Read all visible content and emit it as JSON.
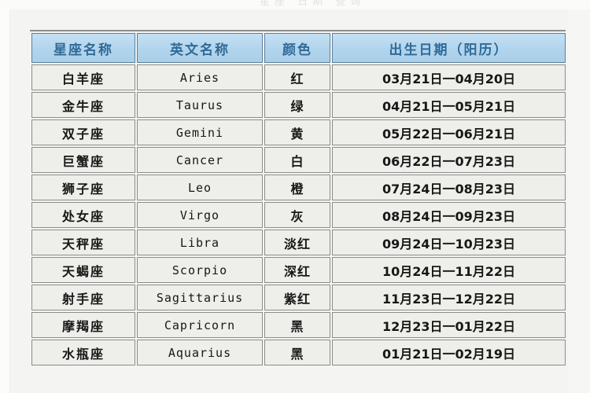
{
  "page": {
    "background_color": "#f4f5f3",
    "top_ghost_text": "星座  日期  查询"
  },
  "table": {
    "name": "zodiac-sign-table",
    "header_background": "#b0d4ee",
    "header_text_color": "#2f6a99",
    "cell_background": "#eeeeea",
    "border_color": "#8a8d8a",
    "columns": [
      {
        "key": "name",
        "label": "星座名称"
      },
      {
        "key": "en",
        "label": "英文名称"
      },
      {
        "key": "color",
        "label": "颜色"
      },
      {
        "key": "date",
        "label": "出生日期（阳历）"
      }
    ],
    "rows": [
      {
        "name": "白羊座",
        "en": "Aries",
        "color": "红",
        "date": "03月21日一04月20日"
      },
      {
        "name": "金牛座",
        "en": "Taurus",
        "color": "绿",
        "date": "04月21日一05月21日"
      },
      {
        "name": "双子座",
        "en": "Gemini",
        "color": "黄",
        "date": "05月22日一06月21日"
      },
      {
        "name": "巨蟹座",
        "en": "Cancer",
        "color": "白",
        "date": "06月22日一07月23日"
      },
      {
        "name": "狮子座",
        "en": "Leo",
        "color": "橙",
        "date": "07月24日一08月23日"
      },
      {
        "name": "处女座",
        "en": "Virgo",
        "color": "灰",
        "date": "08月24日一09月23日"
      },
      {
        "name": "天秤座",
        "en": "Libra",
        "color": "淡红",
        "date": "09月24日一10月23日"
      },
      {
        "name": "天蝎座",
        "en": "Scorpio",
        "color": "深红",
        "date": "10月24日一11月22日"
      },
      {
        "name": "射手座",
        "en": "Sagittarius",
        "color": "紫红",
        "date": "11月23日一12月22日"
      },
      {
        "name": "摩羯座",
        "en": "Capricorn",
        "color": "黑",
        "date": "12月23日一01月22日"
      },
      {
        "name": "水瓶座",
        "en": "Aquarius",
        "color": "黑",
        "date": "01月21日一02月19日"
      }
    ]
  }
}
